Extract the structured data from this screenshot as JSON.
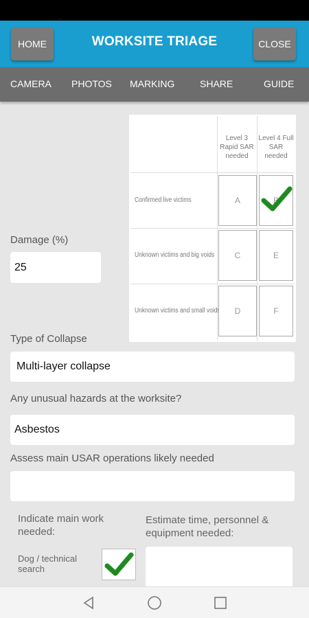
{
  "header": {
    "home_label": "HOME",
    "title": "WORKSITE TRIAGE",
    "close_label": "CLOSE"
  },
  "tabs": [
    {
      "label": "CAMERA"
    },
    {
      "label": "PHOTOS"
    },
    {
      "label": "MARKING"
    },
    {
      "label": "SHARE"
    },
    {
      "label": "GUIDE"
    }
  ],
  "matrix": {
    "col_headers": [
      "Level 3 Rapid SAR needed",
      "Level 4 Full SAR needed"
    ],
    "rows": [
      {
        "label": "Confirmed live victims",
        "cells": [
          "A",
          "B"
        ]
      },
      {
        "label": "Unknown victims and big voids",
        "cells": [
          "C",
          "E"
        ]
      },
      {
        "label": "Unknown victims and small voids",
        "cells": [
          "D",
          "F"
        ]
      }
    ],
    "checked_cell": "B"
  },
  "damage": {
    "label": "Damage (%)",
    "value": "25"
  },
  "collapse": {
    "label": "Type of Collapse",
    "value": "Multi-layer collapse"
  },
  "hazards": {
    "label": "Any unusual hazards at the worksite?",
    "value": "Asbestos"
  },
  "operations": {
    "label": "Assess main USAR operations likely needed",
    "value": ""
  },
  "work": {
    "label": "Indicate main work needed:",
    "items": [
      {
        "label": "Dog / technical search",
        "checked": true
      }
    ]
  },
  "estimate": {
    "label": "Estimate time, personnel & equipment needed:",
    "value": ""
  },
  "colors": {
    "accent": "#1a9ed0",
    "tabbar": "#6d6d6d",
    "check": "#1f8a1f"
  }
}
